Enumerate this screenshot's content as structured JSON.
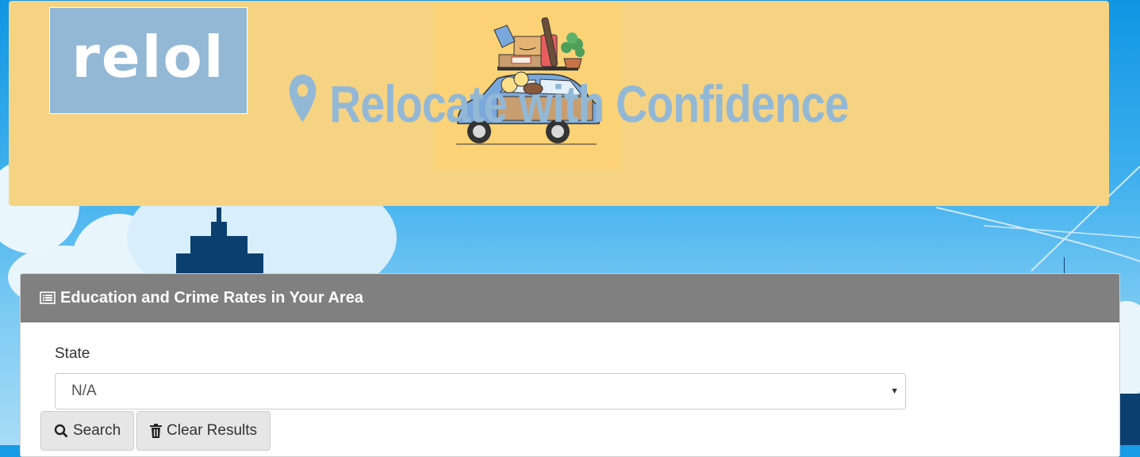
{
  "header": {
    "logo_text": "relol",
    "tagline": "Relocate with Confidence",
    "icons": [
      "map-marker-icon"
    ]
  },
  "panel": {
    "title": "Education and Crime Rates in Your Area",
    "title_icon": "list-alt-icon",
    "state_label": "State",
    "state_value": "N/A",
    "search_label": "Search",
    "clear_label": "Clear Results"
  },
  "colors": {
    "header_bg": "#f6d382",
    "logo_bg": "#93b8d6",
    "tagline": "#93b8d6",
    "panel_head": "#808080",
    "sky": "#1a9be6"
  }
}
